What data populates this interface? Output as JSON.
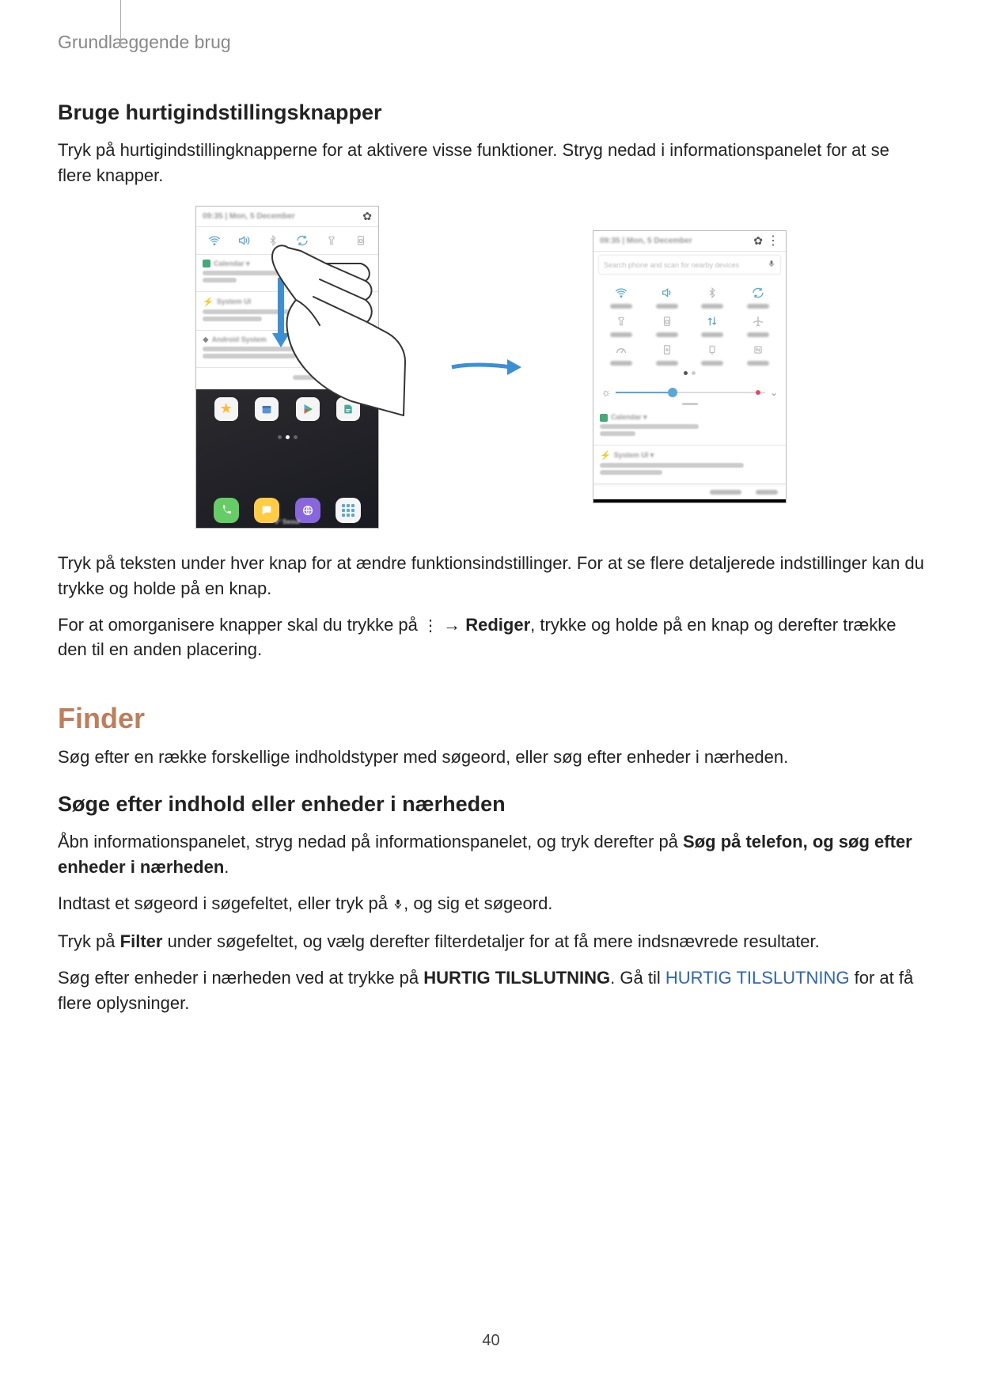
{
  "header": {
    "breadcrumb": "Grundlæggende brug"
  },
  "section1": {
    "title": "Bruge hurtigindstillingsknapper",
    "p1": "Tryk på hurtigindstillingknapperne for at aktivere visse funktioner. Stryg nedad i informationspanelet for at se flere knapper.",
    "p2": "Tryk på teksten under hver knap for at ændre funktionsindstillinger. For at se flere detaljerede indstillinger kan du trykke og holde på en knap.",
    "p3a": "For at omorganisere knapper skal du trykke på ",
    "p3_arrow": " → ",
    "p3_bold": "Rediger",
    "p3b": ", trykke og holde på en knap og derefter trække den til en anden placering."
  },
  "section2": {
    "title": "Finder",
    "intro": "Søg efter en række forskellige indholdstyper med søgeord, eller søg efter enheder i nærheden.",
    "sub1": "Søge efter indhold eller enheder i nærheden",
    "p1a": "Åbn informationspanelet, stryg nedad på informationspanelet, og tryk derefter på ",
    "p1_bold": "Søg på telefon, og søg efter enheder i nærheden",
    "p1b": ".",
    "p2a": "Indtast et søgeord i søgefeltet, eller tryk på ",
    "p2b": ", og sig et søgeord.",
    "p3a": "Tryk på ",
    "p3_bold": "Filter",
    "p3b": " under søgefeltet, og vælg derefter filterdetaljer for at få mere indsnævrede resultater.",
    "p4a": "Søg efter enheder i nærheden ved at trykke på ",
    "p4_bold": "HURTIG TILSLUTNING",
    "p4b": ". Gå til ",
    "p4_link": "HURTIG TILSLUTNING",
    "p4c": " for at få flere oplysninger."
  },
  "page_number": "40",
  "icons": {
    "more_vert": "more-options-icon",
    "mic": "microphone-icon"
  },
  "figure": {
    "left_status_time": "09:35 | Mon, 5 December",
    "right_status_time": "09:35 | Mon, 5 December",
    "search_placeholder": "Search phone and scan for nearby devices"
  }
}
